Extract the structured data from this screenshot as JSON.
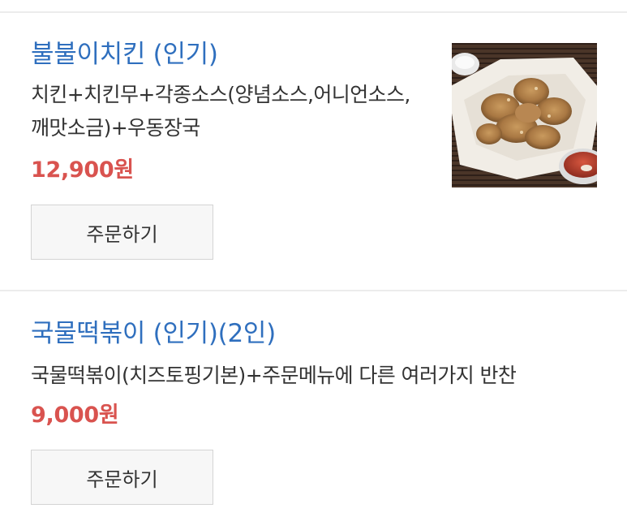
{
  "menu": {
    "items": [
      {
        "title": "불불이치킨 (인기)",
        "description": "치킨+치킨무+각종소스(양념소스,어니언소스,깨맛소금)+우동장국",
        "price": "12,900원",
        "order_label": "주문하기",
        "image": "fried-chicken-photo"
      },
      {
        "title": "국물떡볶이 (인기)(2인)",
        "description": "국물떡볶이(치즈토핑기본)+주문메뉴에 다른 여러가지 반찬",
        "price": "9,000원",
        "order_label": "주문하기"
      }
    ]
  },
  "colors": {
    "title": "#2f6fbe",
    "price": "#d9534f",
    "text": "#333333",
    "button_bg": "#f7f7f7",
    "button_border": "#d4d4d4",
    "divider": "#ececec"
  }
}
